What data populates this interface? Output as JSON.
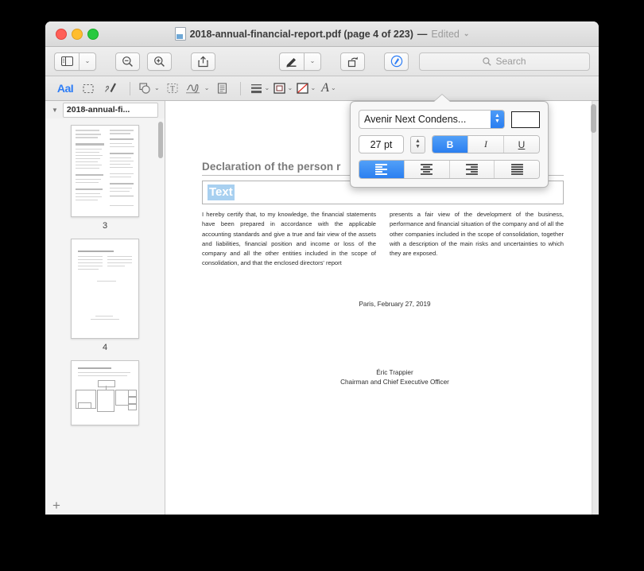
{
  "window": {
    "title_file": "2018-annual-financial-report.pdf (page 4 of 223)",
    "title_dash": "—",
    "title_edited": "Edited",
    "title_chevron": "⌄",
    "traffic": {
      "close": "close-button",
      "minimize": "minimize-button",
      "maximize": "maximize-button"
    }
  },
  "toolbar": {
    "sidebar_toggle": "sidebar-view",
    "sidebar_chevron": "⌄",
    "zoom_out": "zoom-out",
    "zoom_in": "zoom-in",
    "share": "share",
    "markup_pen": "markup-pen",
    "markup_chevron": "⌄",
    "rotate": "rotate-left",
    "annotate": "annotate-toolbar-toggle"
  },
  "search": {
    "placeholder": "Search",
    "value": "",
    "icon": "search-icon"
  },
  "markupbar": {
    "tools": [
      {
        "name": "text-selection-tool",
        "label": "AaI",
        "active": true
      },
      {
        "name": "rectangular-selection-tool",
        "label": "",
        "active": false
      },
      {
        "name": "sketch-tool",
        "label": "",
        "active": false
      },
      {
        "name": "shapes-tool",
        "label": "",
        "chevron": "⌄",
        "active": false
      },
      {
        "name": "text-box-tool",
        "label": "",
        "active": false
      },
      {
        "name": "signature-tool",
        "label": "",
        "chevron": "⌄",
        "active": false
      },
      {
        "name": "note-tool",
        "label": "",
        "active": false
      },
      {
        "name": "line-thickness-tool",
        "label": "",
        "chevron": "⌄",
        "active": false
      },
      {
        "name": "border-color-tool",
        "label": "",
        "chevron": "⌄",
        "active": false
      },
      {
        "name": "fill-color-tool",
        "label": "",
        "chevron": "⌄",
        "active": false
      },
      {
        "name": "text-style-tool",
        "label": "A",
        "chevron": "⌄",
        "active": false
      }
    ]
  },
  "sidebar": {
    "disclosure": "▼",
    "doc_name": "2018-annual-fi...",
    "thumbnails": [
      {
        "page_label": "3"
      },
      {
        "page_label": "4"
      },
      {
        "page_label": ""
      }
    ],
    "add_button": "+"
  },
  "document": {
    "heading": "Declaration of the person r",
    "annotation_text": "Text",
    "column_left": "I hereby certify that, to my knowledge, the financial statements have been prepared in accordance with the applicable accounting standards and give a true and fair view of the assets and liabilities, financial position and income or loss of the company and all the other entities included in the scope of consolidation, and that the enclosed directors' report",
    "column_right": "presents a fair view of the development of the business, performance and financial situation of the company and of all the other companies included in the scope of consolidation, together with a description of the main risks and uncertainties to which they are exposed.",
    "date_line": "Paris, February 27, 2019",
    "signature_name": "Éric Trappier",
    "signature_title": "Chairman and Chief Executive Officer"
  },
  "font_popover": {
    "font_family": "Avenir Next Condens...",
    "font_stepper": "font-family-stepper",
    "color_swatch_hex": "#ffffff",
    "font_size": "27 pt",
    "size_stepper": "font-size-stepper",
    "bold_label": "B",
    "italic_label": "I",
    "underline_label": "U",
    "bold_active": true,
    "italic_active": false,
    "underline_active": false,
    "alignments": [
      {
        "name": "align-left",
        "active": true
      },
      {
        "name": "align-center",
        "active": false
      },
      {
        "name": "align-right",
        "active": false
      },
      {
        "name": "align-justify",
        "active": false
      }
    ]
  },
  "colors": {
    "accent": "#2b7ff0",
    "selection": "#a8d0f0",
    "desktop": "#000000"
  }
}
